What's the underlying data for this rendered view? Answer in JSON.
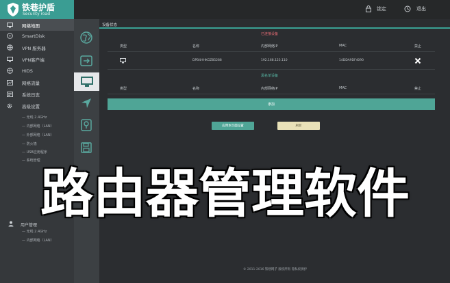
{
  "brand": {
    "title": "铁巷护盾",
    "subtitle": "Security road"
  },
  "topbar": {
    "lock_label": "锁定",
    "logout_label": "退出"
  },
  "sidebar": {
    "items": [
      {
        "label": "网络地图",
        "icon": "monitor-icon"
      },
      {
        "label": "SmartDisk",
        "icon": "disk-icon"
      },
      {
        "label": "VPN 服务器",
        "icon": "globe-icon"
      },
      {
        "label": "VPN客户端",
        "icon": "monitor-icon"
      },
      {
        "label": "HIDS",
        "icon": "globe-icon"
      },
      {
        "label": "网络流量",
        "icon": "chart-icon"
      },
      {
        "label": "系统日志",
        "icon": "list-icon"
      },
      {
        "label": "高级设置",
        "icon": "gear-icon"
      }
    ],
    "sub_items": [
      "— 无线 2.4GHz",
      "— 内部网络（LAN）",
      "— 外部网络（LAN）",
      "— 防火墙",
      "— USB应用程序",
      "— 系统管理"
    ],
    "user_group": {
      "label": "用户管理",
      "sub_items": [
        "— 无线 2.4GHz",
        "— 内部网络（LAN）"
      ]
    }
  },
  "content": {
    "panel_title": "设备状态",
    "online_title": "已连接设备",
    "blocked_title": "黑名单设备",
    "headers": [
      "类型",
      "名称",
      "内部网络IP",
      "MAC",
      "禁止"
    ],
    "online_rows": [
      {
        "name": "DPB4HHKGZ85288",
        "ip": "192.168.123.110",
        "mac": "14DDA9DF4090"
      }
    ],
    "add_label": "添加",
    "apply_label": "应用本页面设置",
    "refresh_label": "刷新",
    "footer": "© 2011-2016 铁巷网子  版权所有  隐私权保护"
  },
  "caption": "路由器管理软件",
  "colors": {
    "accent": "#3aa396",
    "danger_title": "#e06a72",
    "topbar": "#262829"
  }
}
